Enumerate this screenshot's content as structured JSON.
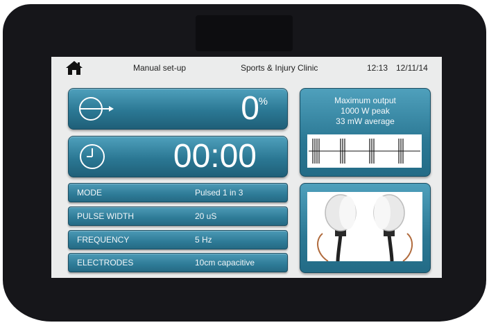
{
  "header": {
    "mode": "Manual set-up",
    "clinic": "Sports & Injury Clinic",
    "time": "12:13",
    "date": "12/11/14"
  },
  "output": {
    "value": "0",
    "unit": "%"
  },
  "timer": {
    "value": "00:00"
  },
  "settings": [
    {
      "label": "MODE",
      "value": "Pulsed 1 in 3"
    },
    {
      "label": "PULSE WIDTH",
      "value": "20 uS"
    },
    {
      "label": "FREQUENCY",
      "value": "5 Hz"
    },
    {
      "label": "ELECTRODES",
      "value": "10cm capacitive"
    }
  ],
  "info": {
    "line1": "Maximum output",
    "line2": "1000 W peak",
    "line3": "33 mW average"
  },
  "icons": {
    "home": "home-icon",
    "output": "output-dial-icon",
    "timer": "clock-icon",
    "pulse": "pulse-waveform",
    "electrodes": "electrodes-image"
  },
  "colors": {
    "accent": "#2b7894",
    "bezel": "#16161a",
    "screen": "#ebecec"
  }
}
